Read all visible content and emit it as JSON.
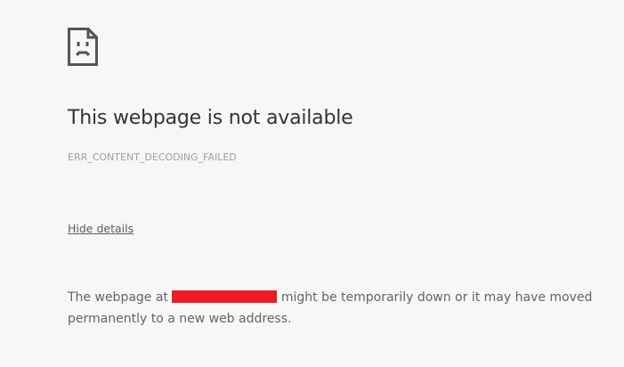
{
  "error_page": {
    "icon": "sad-page-icon",
    "title": "This webpage is not available",
    "error_code": "ERR_CONTENT_DECODING_FAILED",
    "details_toggle_label": "Hide details",
    "details_prefix": "The webpage at",
    "details_suffix": "might be temporarily down or it may have moved permanently to a new web address.",
    "redaction_color": "#ed1c24"
  }
}
